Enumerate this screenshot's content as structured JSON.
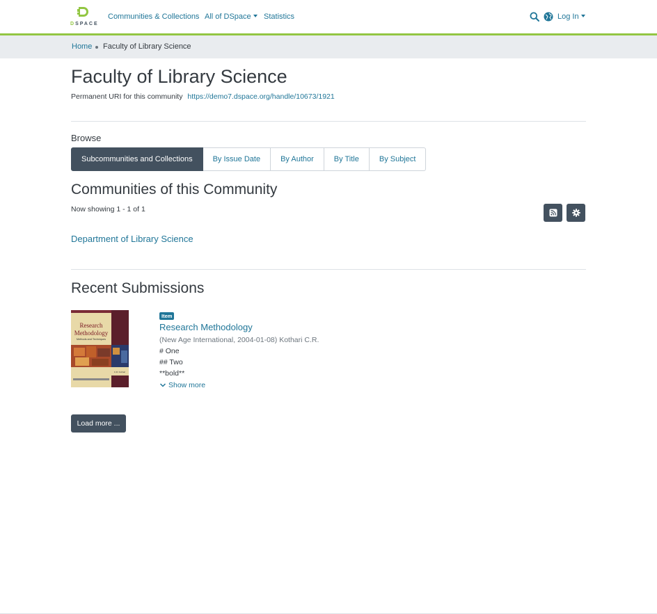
{
  "header": {
    "logo_text": "DSPACE",
    "nav": [
      {
        "label": "Communities & Collections"
      },
      {
        "label": "All of DSpace"
      },
      {
        "label": "Statistics"
      }
    ],
    "login_label": "Log In",
    "accent_color": "#92c642"
  },
  "breadcrumb": {
    "home": "Home",
    "current": "Faculty of Library Science"
  },
  "page": {
    "title": "Faculty of Library Science",
    "uri_label": "Permanent URI for this community",
    "uri_value": "https://demo7.dspace.org/handle/10673/1921"
  },
  "browse": {
    "label": "Browse",
    "tabs": [
      {
        "label": "Subcommunities and Collections",
        "active": true
      },
      {
        "label": "By Issue Date"
      },
      {
        "label": "By Author"
      },
      {
        "label": "By Title"
      },
      {
        "label": "By Subject"
      }
    ]
  },
  "communities": {
    "title": "Communities of this Community",
    "showing": "Now showing 1 - 1 of 1",
    "items": [
      {
        "label": "Department of Library Science"
      }
    ],
    "buttons": [
      {
        "icon": "rss-icon"
      },
      {
        "icon": "gear-icon"
      }
    ]
  },
  "recent": {
    "title": "Recent Submissions",
    "items": [
      {
        "badge": "Item",
        "title": "Research Methodology",
        "meta": "(New Age International, 2004-01-08) Kothari C.R.",
        "abstract_lines": [
          "# One",
          "## Two",
          "**bold**"
        ],
        "show_more": "Show more",
        "thumbnail": {
          "title_line1": "Research",
          "title_line2": "Methodology",
          "subtitle": "Methods and Techniques",
          "author": "C.R. Kothari"
        }
      }
    ],
    "load_more": "Load more ..."
  }
}
